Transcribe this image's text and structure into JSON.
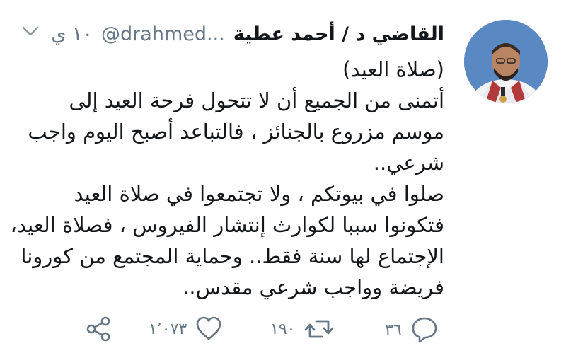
{
  "tweet": {
    "display_name": "القاضي د / أحمد عطية",
    "handle": "@drahmed...",
    "time": "١٠ ي",
    "lines": [
      "(صلاة العيد)",
      "أتمنى من الجميع أن لا تتحول فرحة العيد إلى",
      "موسم مزروع بالجنائز ، فالتباعد أصبح اليوم واجب",
      "شرعي..",
      "صلوا في بيوتكم ، ولا تجتمعوا في صلاة العيد",
      "فتكونوا سببا لكوارث إنتشار الفيروس ، فصلاة العيد،",
      "الإجتماع لها سنة فقط.. وحماية المجتمع من كورونا",
      "فريضة وواجب شرعي مقدس.."
    ]
  },
  "actions": {
    "share_icon": "share-icon",
    "like_icon": "heart-icon",
    "likes_count": "١٬٠٧٣",
    "retweet_icon": "retweet-icon",
    "retweets_count": "١٩٠",
    "reply_icon": "reply-icon",
    "replies_count": "٣٦"
  },
  "colors": {
    "text": "#14171a",
    "secondary": "#657786",
    "avatar_bg": "#5a88c2"
  }
}
